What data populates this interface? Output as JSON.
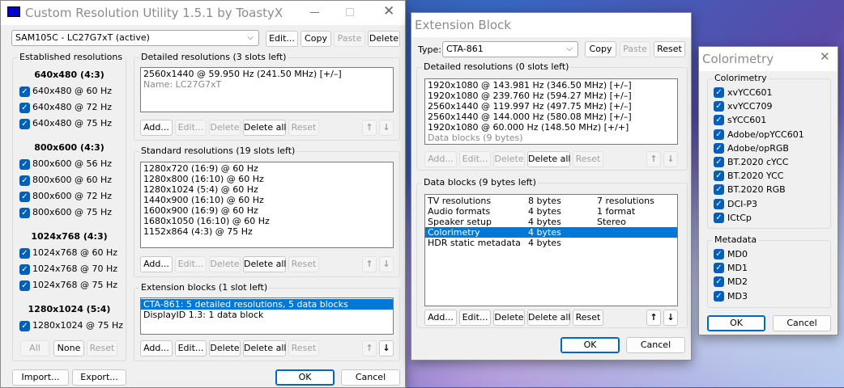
{
  "main": {
    "title": "Custom Resolution Utility 1.5.1 by ToastyX",
    "display_select": "SAM105C - LC27G7xT (active)",
    "top_buttons": {
      "edit": "Edit...",
      "copy": "Copy",
      "paste": "Paste",
      "delete": "Delete"
    },
    "established": {
      "label": "Established resolutions",
      "groups": [
        {
          "header": "640x480 (4:3)",
          "items": [
            "640x480 @ 60 Hz",
            "640x480 @ 72 Hz",
            "640x480 @ 75 Hz"
          ]
        },
        {
          "header": "800x600 (4:3)",
          "items": [
            "800x600 @ 56 Hz",
            "800x600 @ 60 Hz",
            "800x600 @ 72 Hz",
            "800x600 @ 75 Hz"
          ]
        },
        {
          "header": "1024x768 (4:3)",
          "items": [
            "1024x768 @ 60 Hz",
            "1024x768 @ 70 Hz",
            "1024x768 @ 75 Hz"
          ]
        },
        {
          "header": "1280x1024 (5:4)",
          "items": [
            "1280x1024 @ 75 Hz"
          ]
        }
      ],
      "buttons": {
        "all": "All",
        "none": "None",
        "reset": "Reset"
      }
    },
    "detailed": {
      "label": "Detailed resolutions (3 slots left)",
      "rows": [
        {
          "text": "2560x1440 @ 59.950 Hz (241.50 MHz) [+/–]"
        },
        {
          "text": "Name: LC27G7xT",
          "gray": true
        }
      ]
    },
    "standard": {
      "label": "Standard resolutions (19 slots left)",
      "rows": [
        {
          "text": "1280x720 (16:9) @ 60 Hz"
        },
        {
          "text": "1280x800 (16:10) @ 60 Hz"
        },
        {
          "text": "1280x1024 (5:4) @ 60 Hz"
        },
        {
          "text": "1440x900 (16:10) @ 60 Hz"
        },
        {
          "text": "1600x900 (16:9) @ 60 Hz"
        },
        {
          "text": "1680x1050 (16:10) @ 60 Hz"
        },
        {
          "text": "1152x864 (4:3) @ 75 Hz"
        }
      ]
    },
    "extension": {
      "label": "Extension blocks (1 slot left)",
      "rows": [
        {
          "text": "CTA-861: 5 detailed resolutions, 5 data blocks",
          "selected": true
        },
        {
          "text": "DisplayID 1.3: 1 data block"
        }
      ]
    },
    "list_buttons": {
      "add": "Add...",
      "edit": "Edit...",
      "delete": "Delete",
      "delete_all": "Delete all",
      "reset": "Reset",
      "up": "↑",
      "down": "↓"
    },
    "bottom": {
      "import": "Import...",
      "export": "Export...",
      "ok": "OK",
      "cancel": "Cancel"
    }
  },
  "ext": {
    "title": "Extension Block",
    "type_label": "Type:",
    "type_value": "CTA-861",
    "buttons": {
      "copy": "Copy",
      "paste": "Paste",
      "reset": "Reset"
    },
    "detailed": {
      "label": "Detailed resolutions (0 slots left)",
      "rows": [
        {
          "text": "1920x1080 @ 143.981 Hz (346.50 MHz) [+/–]"
        },
        {
          "text": "1920x1080 @ 239.760 Hz (594.27 MHz) [+/–]"
        },
        {
          "text": "2560x1440 @ 119.997 Hz (497.75 MHz) [+/–]"
        },
        {
          "text": "2560x1440 @ 144.000 Hz (580.08 MHz) [+/–]"
        },
        {
          "text": "1920x1080 @ 60.000 Hz (148.50 MHz) [+/+]"
        },
        {
          "text": "Data blocks (9 bytes)",
          "gray": true
        }
      ]
    },
    "datablocks": {
      "label": "Data blocks (9 bytes left)",
      "rows": [
        {
          "name": "TV resolutions",
          "size": "8 bytes",
          "info": "7 resolutions"
        },
        {
          "name": "Audio formats",
          "size": "4 bytes",
          "info": "1 format"
        },
        {
          "name": "Speaker setup",
          "size": "4 bytes",
          "info": "Stereo"
        },
        {
          "name": "Colorimetry",
          "size": "4 bytes",
          "info": "",
          "selected": true
        },
        {
          "name": "HDR static metadata",
          "size": "4 bytes",
          "info": ""
        }
      ]
    },
    "ok": "OK",
    "cancel": "Cancel"
  },
  "color": {
    "title": "Colorimetry",
    "colorimetry_label": "Colorimetry",
    "colorimetry": [
      "xvYCC601",
      "xvYCC709",
      "sYCC601",
      "Adobe/opYCC601",
      "Adobe/opRGB",
      "BT.2020 cYCC",
      "BT.2020 YCC",
      "BT.2020 RGB",
      "DCI-P3",
      "ICtCp"
    ],
    "metadata_label": "Metadata",
    "metadata": [
      "MD0",
      "MD1",
      "MD2",
      "MD3"
    ],
    "ok": "OK",
    "cancel": "Cancel"
  },
  "colors": {
    "accent": "#0078d7",
    "checkbox": "#005fb8"
  }
}
